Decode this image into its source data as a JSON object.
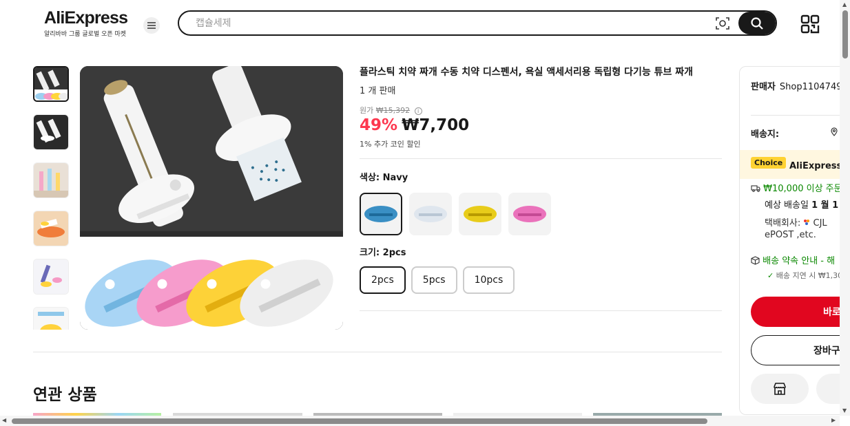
{
  "header": {
    "logo_text": "AliExpress",
    "logo_tagline": "알리바바 그룹 글로벌 오픈 마켓",
    "search_placeholder": "캡슐세제"
  },
  "product": {
    "title": "플라스틱 치약 짜개 수동 치약 디스펜서, 욕실 액세서리용 독립형 다기능 튜브 짜개",
    "sold": "1 개 판매",
    "original_price_label": "원가",
    "original_price": "₩15,392",
    "discount": "49%",
    "price": "₩7,700",
    "coin_discount": "1% 추가 코인 할인",
    "color_label": "색상: ",
    "color_value": "Navy",
    "colors": [
      {
        "name": "Navy",
        "hex": "#3a8fc4"
      },
      {
        "name": "White",
        "hex": "#e8ecf2"
      },
      {
        "name": "Yellow",
        "hex": "#e8cc1a"
      },
      {
        "name": "Pink",
        "hex": "#ea72bb"
      }
    ],
    "size_label": "크기: ",
    "size_value": "2pcs",
    "sizes": [
      "2pcs",
      "5pcs",
      "10pcs"
    ]
  },
  "related_title": "연관 상품",
  "panel": {
    "seller_label": "판매자",
    "seller_name": "Shop1104749",
    "ship_to_label": "배송지:",
    "choice_badge": "Choice",
    "choice_name": "AliExpress상점",
    "free_shipping": "₩10,000 이상 주문",
    "eta_prefix": "예상 배송일 ",
    "eta_value": "1 월 1",
    "carrier_label": "택배회사: ",
    "carrier_name": "CJL",
    "carrier_more": "ePOST ,etc.",
    "promise": "배송 약속 안내 - 해",
    "delay": "배송 지연 시 ₩1,30",
    "buy_label": "바로",
    "cart_label": "장바구"
  },
  "colors": {
    "accent_red": "#e1061f",
    "discount_red": "#fd384f",
    "green": "#0a8800",
    "choice_yellow": "#ffd232"
  }
}
